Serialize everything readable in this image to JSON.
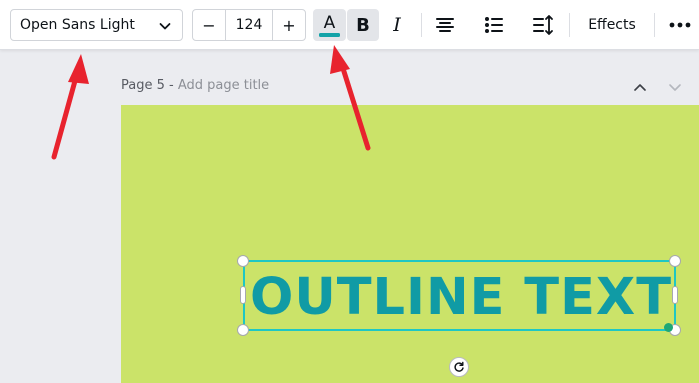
{
  "toolbar": {
    "font_family": "Open Sans Light",
    "font_size": "124",
    "decrease_label": "−",
    "increase_label": "+",
    "text_color_letter": "A",
    "text_color": "#13a3a8",
    "bold_letter": "B",
    "italic_letter": "I",
    "effects_label": "Effects",
    "more_label": "•••"
  },
  "canvas": {
    "page_number": "Page 5 -",
    "page_title_placeholder": "Add page title",
    "page_background": "#cbe369",
    "text_content": "OUTLINE TEXT",
    "text_color": "#109ba5",
    "selection_color": "#1ec7c5"
  },
  "annotations": {
    "arrow_color": "#e8232e"
  }
}
